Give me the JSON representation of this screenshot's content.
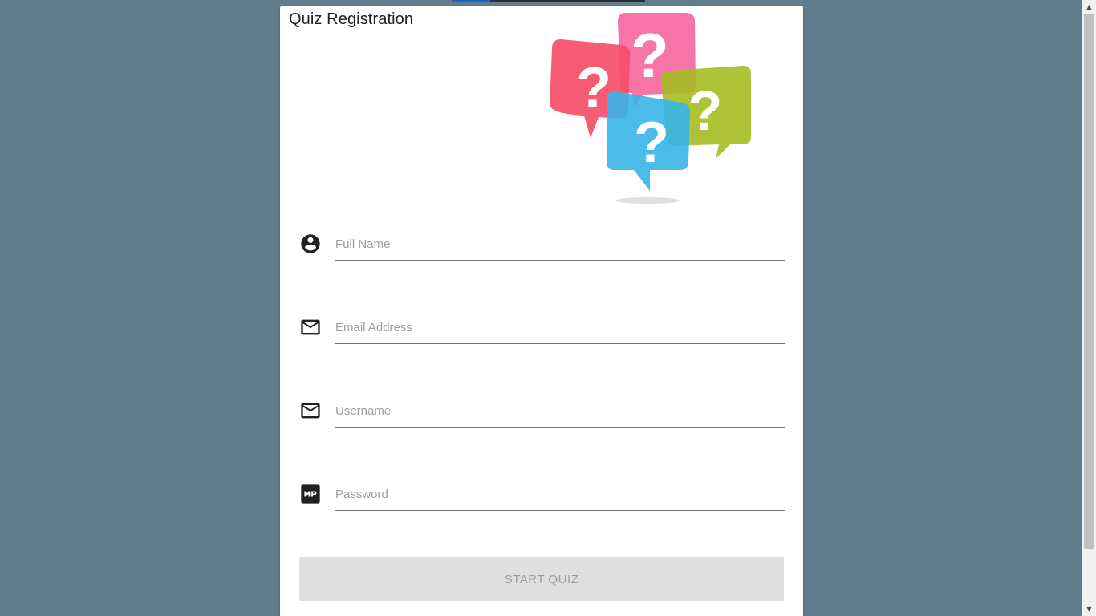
{
  "form": {
    "title": "Quiz Registration",
    "fields": [
      {
        "icon": "account-circle-icon",
        "placeholder": "Full Name",
        "value": ""
      },
      {
        "icon": "mail-icon",
        "placeholder": "Email Address",
        "value": ""
      },
      {
        "icon": "mail-icon",
        "placeholder": "Username",
        "value": ""
      },
      {
        "icon": "mp-icon",
        "placeholder": "Password",
        "value": ""
      }
    ],
    "submit_label": "START QUIZ"
  },
  "colors": {
    "background": "#607d8b",
    "card": "#ffffff",
    "button_disabled": "#dfdfdf",
    "bubble_red": "#f6506a",
    "bubble_pink": "#f7669e",
    "bubble_green": "#a7bd24",
    "bubble_blue": "#38b4e8"
  },
  "illustration": {
    "glyph": "?"
  },
  "scrollbar": {
    "up_arrow": "▲",
    "down_arrow": "▼"
  }
}
